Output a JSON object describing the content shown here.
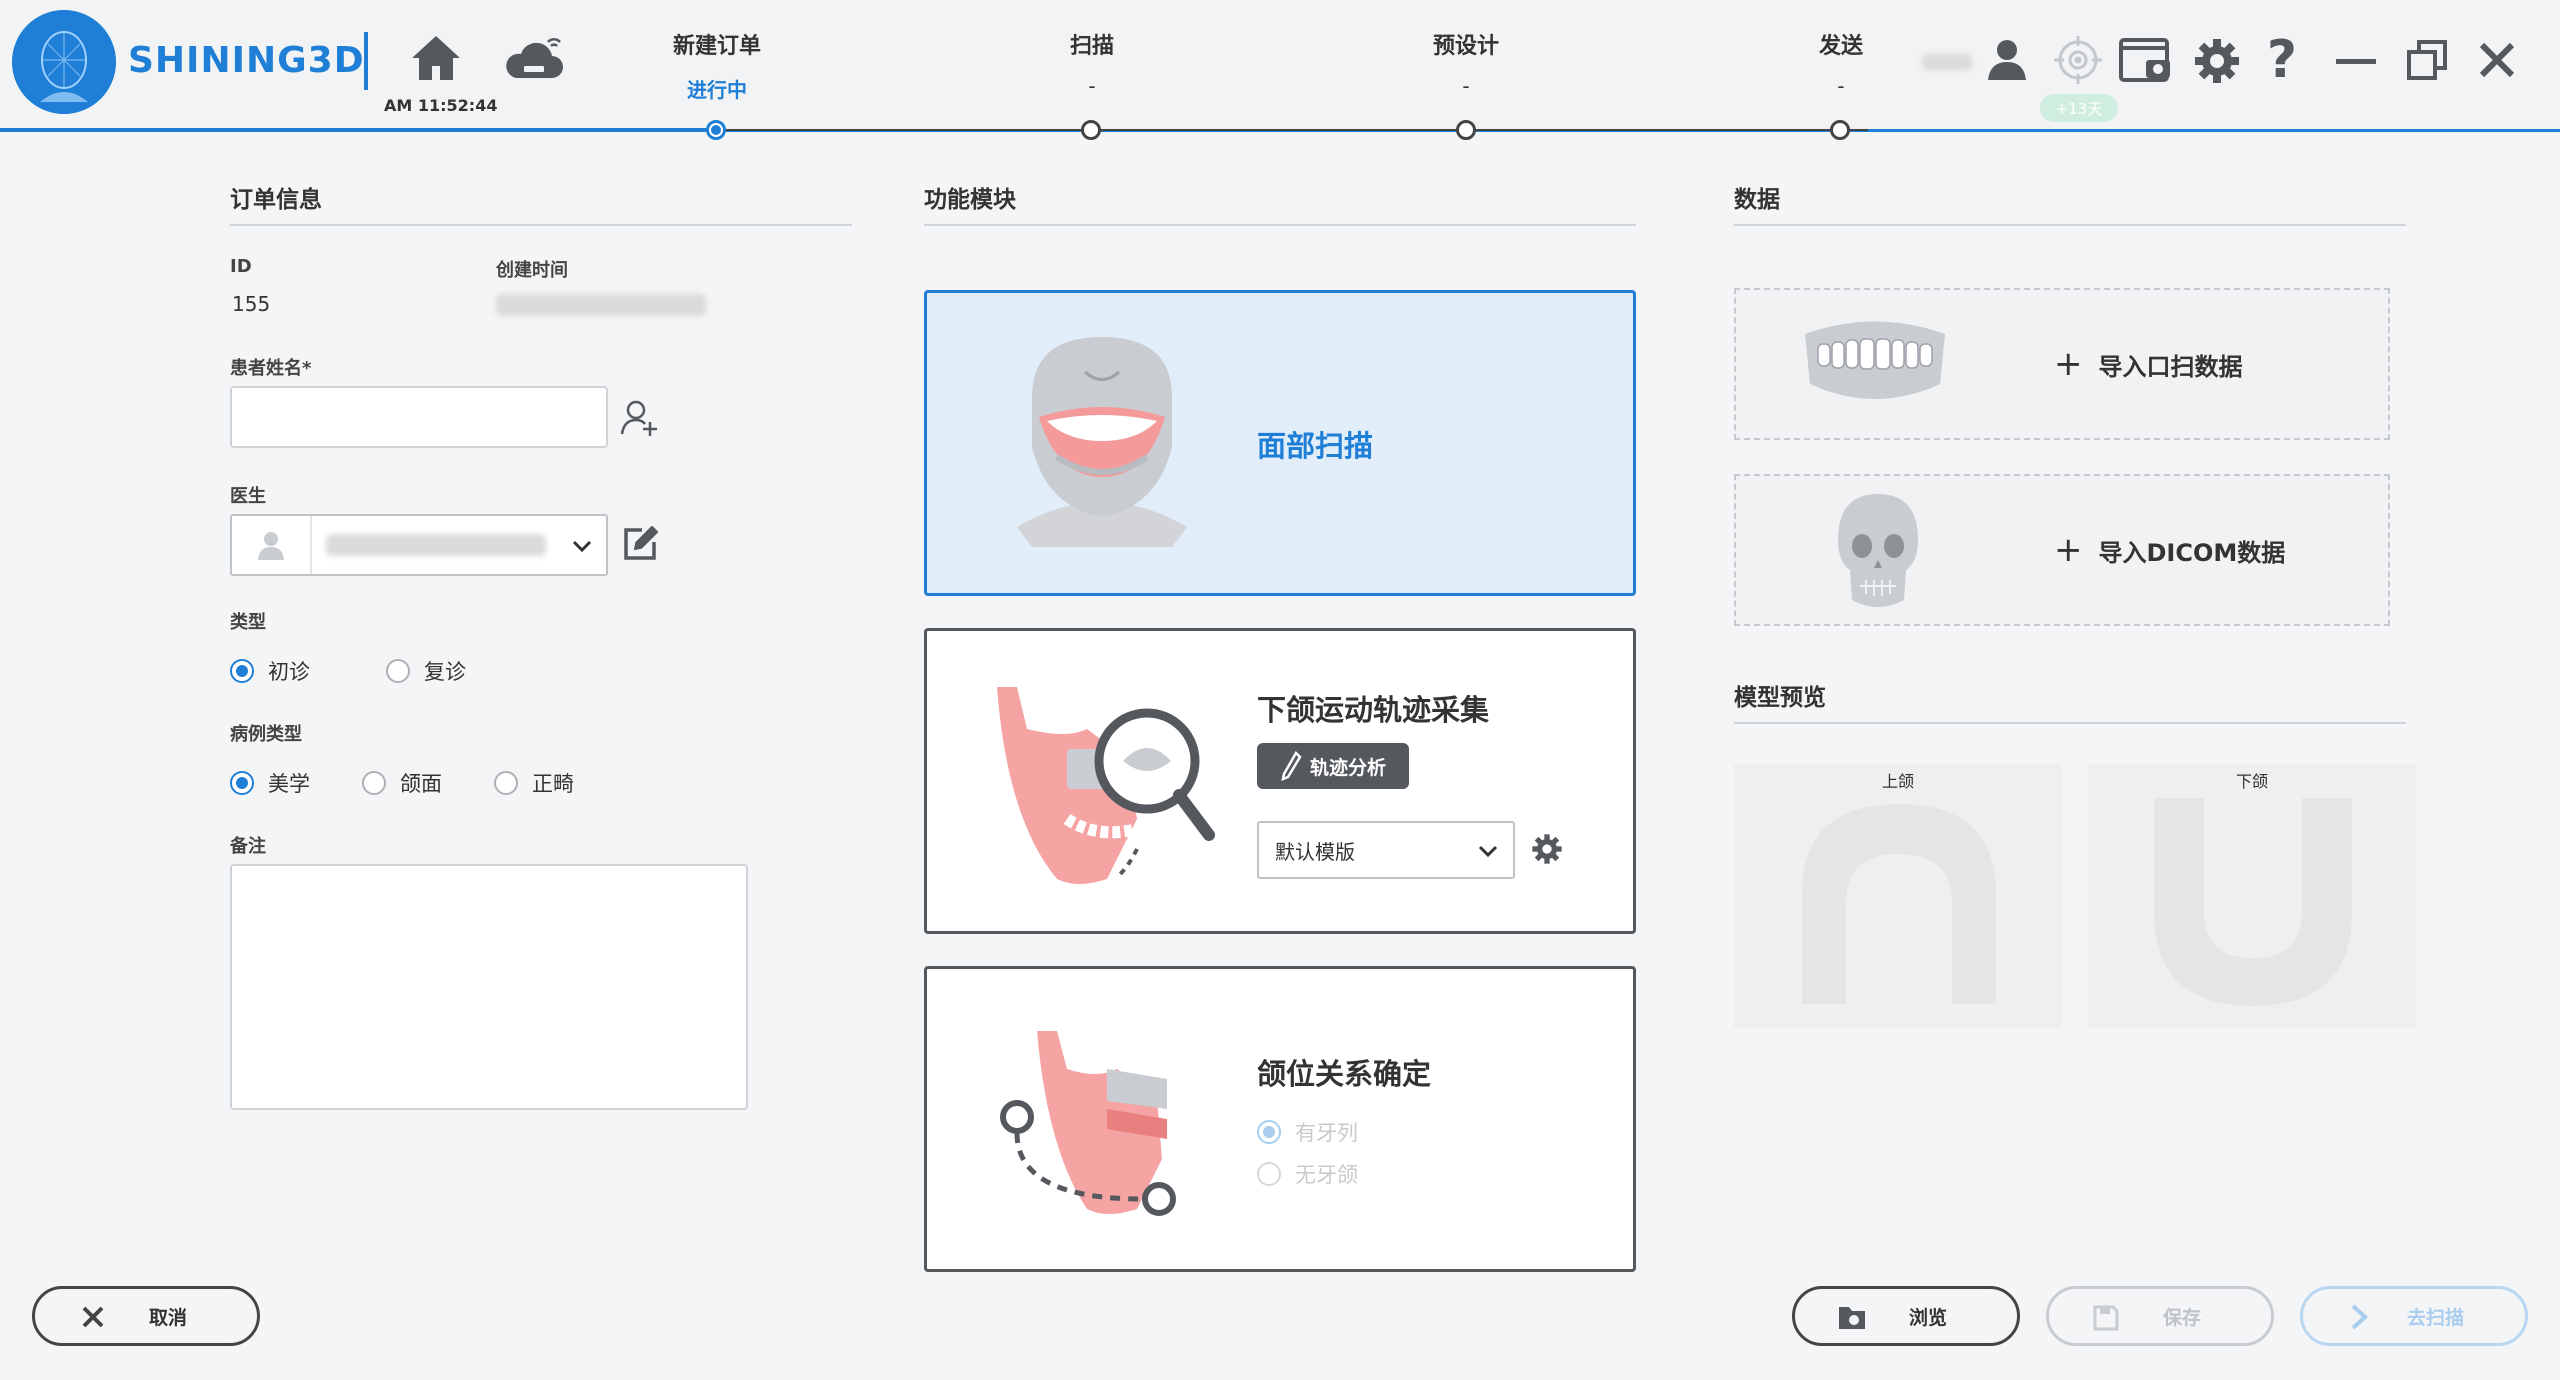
{
  "header": {
    "brand": "SHINING3D",
    "clock": "AM 11:52:44",
    "badge": "+13天"
  },
  "steps": [
    {
      "title": "新建订单",
      "status": "进行中"
    },
    {
      "title": "扫描",
      "status": "-"
    },
    {
      "title": "预设计",
      "status": "-"
    },
    {
      "title": "发送",
      "status": "-"
    }
  ],
  "order": {
    "section_title": "订单信息",
    "id_label": "ID",
    "id_value": "155",
    "created_label": "创建时间",
    "patient_label": "患者姓名*",
    "patient_value": "",
    "doctor_label": "医生",
    "type_label": "类型",
    "type_options": [
      "初诊",
      "复诊"
    ],
    "type_selected": "初诊",
    "case_type_label": "病例类型",
    "case_type_options": [
      "美学",
      "颌面",
      "正畸"
    ],
    "case_type_selected": "美学",
    "notes_label": "备注",
    "notes_value": ""
  },
  "modules": {
    "section_title": "功能模块",
    "face_scan": "面部扫描",
    "mandible": {
      "title": "下颌运动轨迹采集",
      "analysis_button": "轨迹分析",
      "template_value": "默认模版"
    },
    "jaw_relation": {
      "title": "颌位关系确定",
      "options": [
        "有牙列",
        "无牙颌"
      ],
      "selected": "有牙列"
    }
  },
  "data_panel": {
    "section_title": "数据",
    "import_intraoral": "导入口扫数据",
    "import_dicom": "导入DICOM数据",
    "preview_title": "模型预览",
    "upper_jaw": "上颌",
    "lower_jaw": "下颌"
  },
  "footer": {
    "cancel": "取消",
    "browse": "浏览",
    "save": "保存",
    "go_scan": "去扫描"
  },
  "colors": {
    "accent": "#1f7fd6",
    "dark": "#55595e",
    "disabled": "#c9ccd0",
    "pink": "#f5a3a3"
  }
}
